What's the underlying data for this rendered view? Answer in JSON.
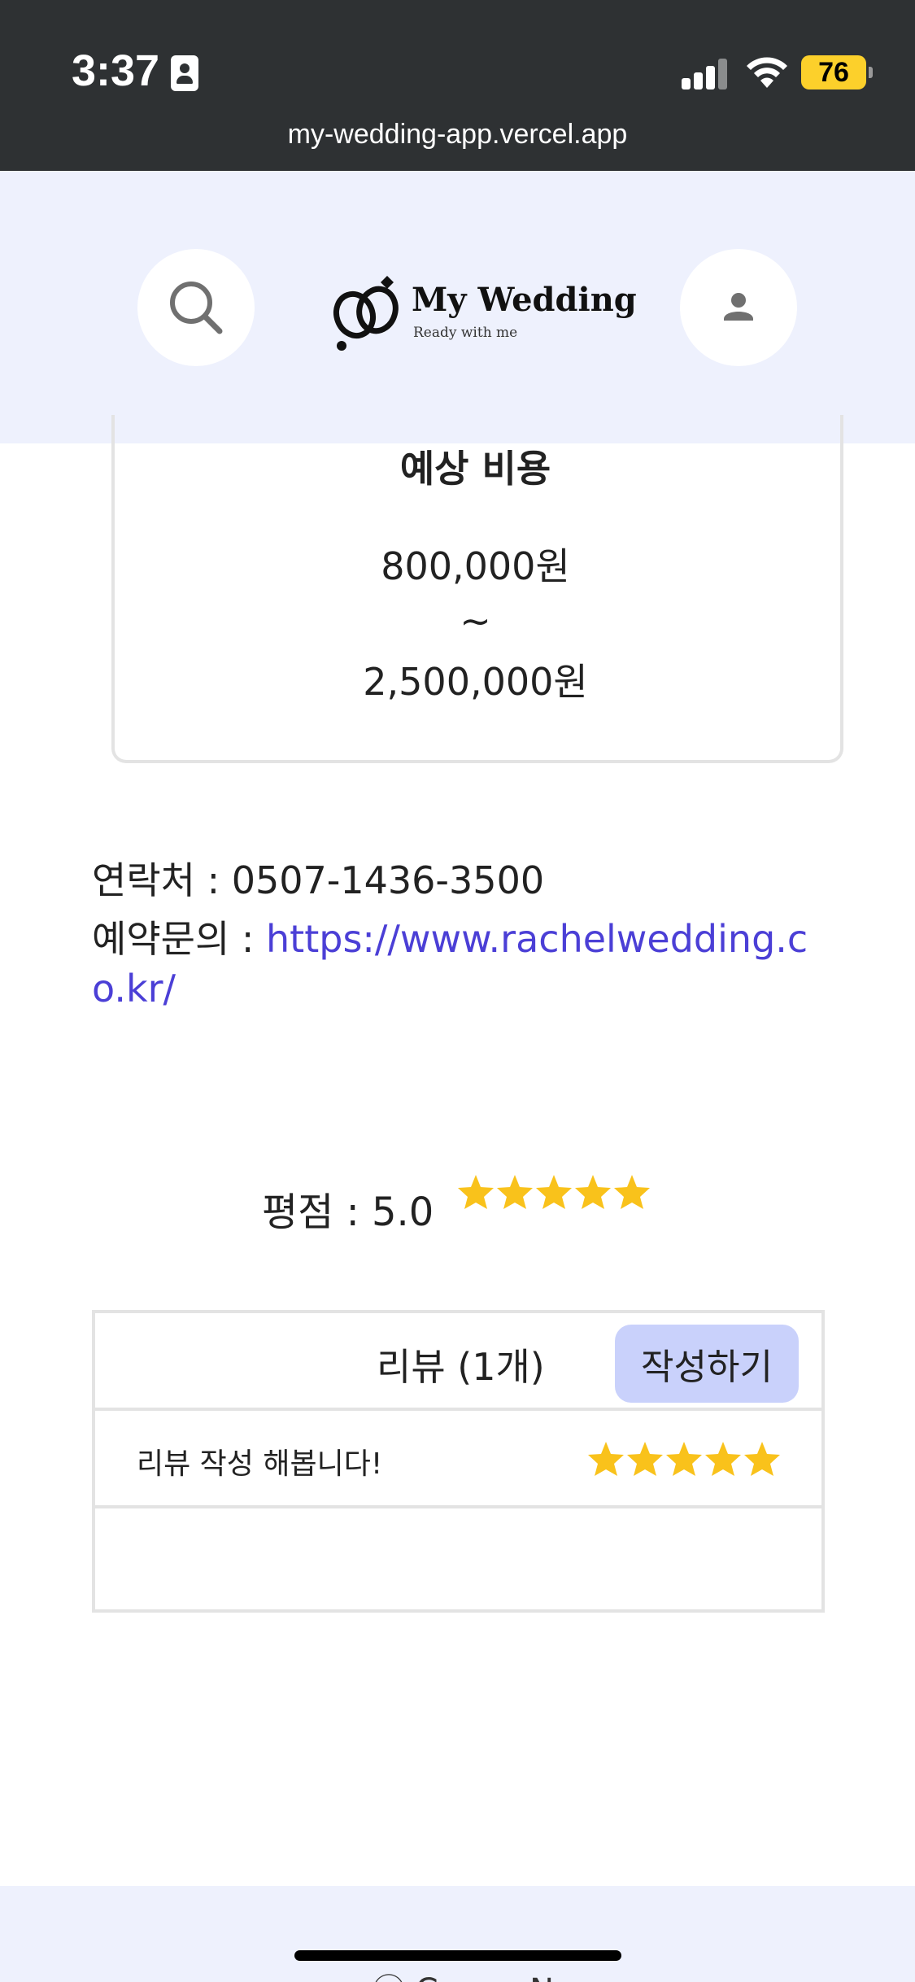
{
  "status_bar": {
    "time": "3:37",
    "battery": "76",
    "url": "my-wedding-app.vercel.app"
  },
  "header": {
    "logo_title": "My Wedding",
    "logo_subtitle": "Ready with me",
    "search_icon": "search-icon",
    "profile_icon": "person-icon"
  },
  "cost": {
    "title": "예상 비용",
    "min": "800,000원",
    "separator": "~",
    "max": "2,500,000원"
  },
  "contact": {
    "phone_label": "연락처 : ",
    "phone": "0507-1436-3500",
    "inquiry_label": "예약문의 : ",
    "url_line1": "https://www.rachelwedding.c",
    "url_line2": "o.kr/"
  },
  "rating": {
    "label": "평점 : 5.0",
    "value": 5.0,
    "max": 5
  },
  "reviews": {
    "header": "리뷰 (1개)",
    "write_button": "작성하기",
    "items": [
      {
        "text": "리뷰 작성 해봅니다!",
        "stars": 5
      }
    ]
  },
  "footer": {
    "text": "ⓒ Coupe No"
  },
  "colors": {
    "accent": "#4b3fd6",
    "header_bg": "#eef1fd",
    "star": "#f9c21b",
    "button_bg": "#c9d1fb"
  }
}
